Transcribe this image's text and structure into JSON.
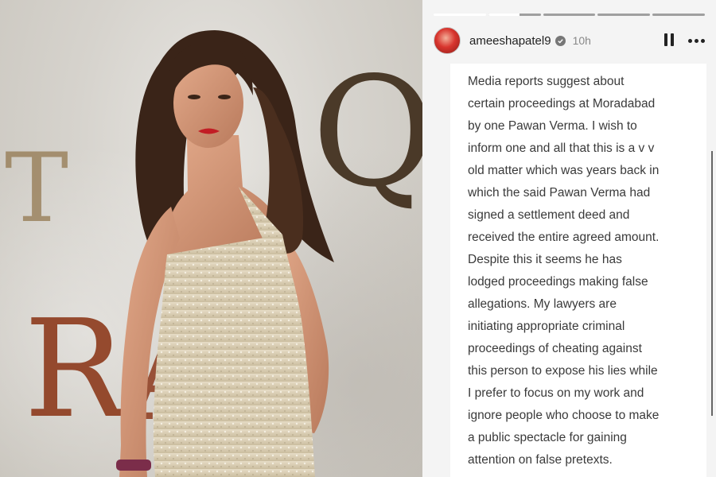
{
  "photo": {
    "backdrop_letters": [
      "Q",
      "T",
      "R",
      "A"
    ]
  },
  "story": {
    "progress": [
      1,
      0.6,
      0,
      0,
      0
    ],
    "username": "ameeshapatel9",
    "time": "10h",
    "icons": [
      "verified-icon",
      "pause-icon",
      "more-icon"
    ],
    "text_lines": [
      "Media reports suggest about",
      "certain proceedings at Moradabad",
      "by one Pawan Verma. I wish to",
      "inform one and all that this is a v v",
      "old matter which was years back in",
      "which the said Pawan Verma had",
      "signed a settlement deed and",
      "received the entire agreed amount.",
      "Despite this it seems he has",
      "lodged proceedings making false",
      "allegations. My lawyers are",
      "initiating appropriate criminal",
      "proceedings of cheating against",
      "this person to expose his lies while",
      "I prefer to focus on my work and",
      "ignore people who choose to make",
      "a public spectacle for gaining",
      "attention on false pretexts."
    ]
  }
}
